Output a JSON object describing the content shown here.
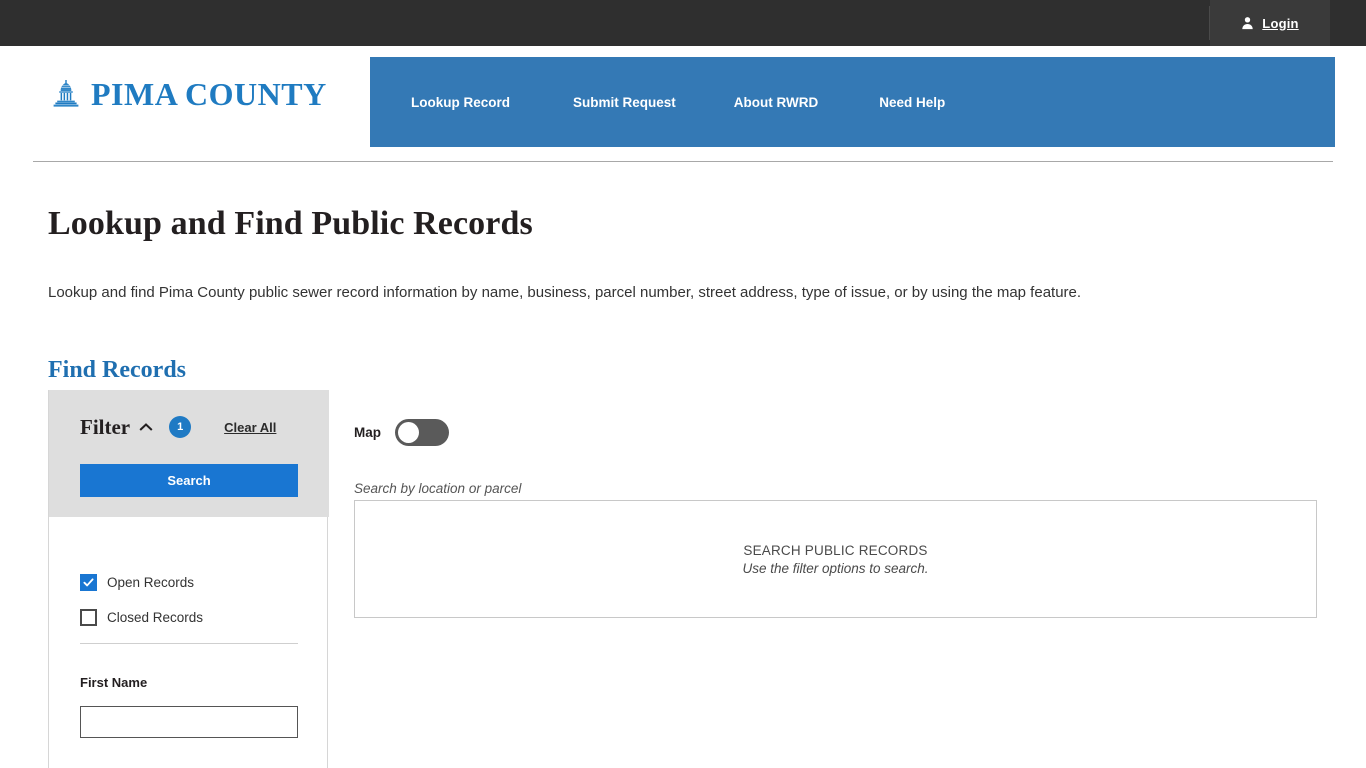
{
  "topbar": {
    "login_label": "Login",
    "person_icon": "person-icon"
  },
  "header": {
    "brand_text": "PIMA COUNTY",
    "brand_icon": "capitol-dome-icon",
    "nav_items": [
      {
        "label": "Lookup Record"
      },
      {
        "label": "Submit Request"
      },
      {
        "label": "About RWRD"
      },
      {
        "label": "Need Help"
      }
    ]
  },
  "page": {
    "title": "Lookup and Find Public Records",
    "description": "Lookup and find Pima County public sewer record information by name, business, parcel number, street address, type of issue, or by using the map feature.",
    "section_title": "Find Records"
  },
  "filter": {
    "title": "Filter",
    "collapse_icon": "chevron-up-icon",
    "badge_count": "1",
    "clear_all_label": "Clear All",
    "search_label": "Search",
    "checkboxes": [
      {
        "label": "Open Records",
        "checked": true
      },
      {
        "label": "Closed Records",
        "checked": false
      }
    ],
    "first_name_label": "First Name",
    "first_name_value": "",
    "first_name_placeholder": ""
  },
  "map": {
    "label": "Map",
    "toggle_state": "off",
    "hint": "Search by location or parcel"
  },
  "results": {
    "title": "SEARCH PUBLIC RECORDS",
    "subtitle": "Use the filter options to search."
  },
  "colors": {
    "topbar": "#2f2f2f",
    "nav_blue": "#3479b5",
    "brand_blue": "#1f7bc1",
    "accent_blue": "#1976d2",
    "heading_blue": "#1f6fb0",
    "panel_gray": "#dedede",
    "toggle_off": "#5a5a5a"
  }
}
